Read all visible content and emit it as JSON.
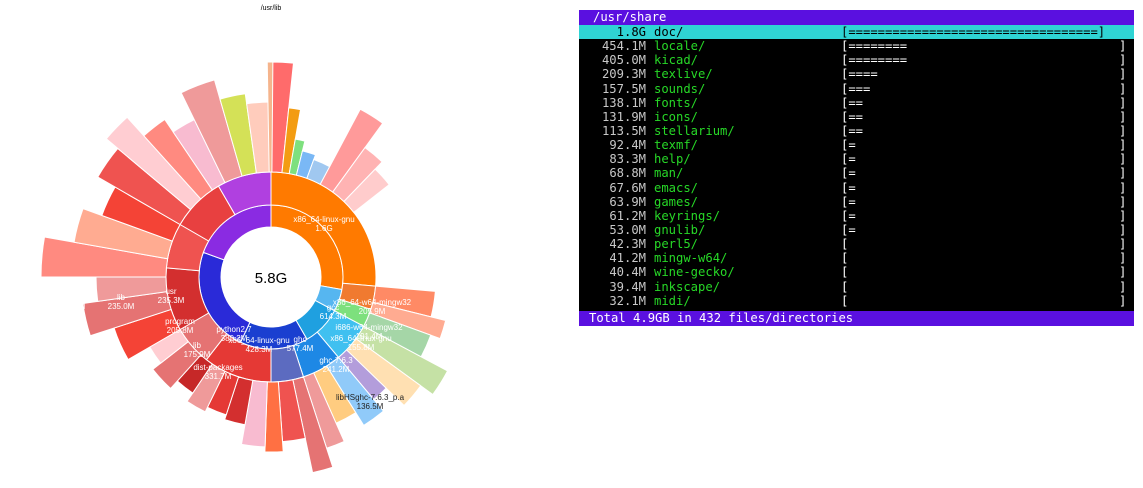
{
  "sunburst": {
    "root_label": "/usr/lib",
    "center_total": "5.8G",
    "labels": [
      {
        "name": "x86_64-linux-gnu",
        "size": "1.6G"
      },
      {
        "name": "usr",
        "size": "235.3M"
      },
      {
        "name": "lib",
        "size": "235.0M"
      },
      {
        "name": "valgrind",
        "size": "227.9M"
      },
      {
        "name": "program",
        "size": "205.8M"
      },
      {
        "name": "lib",
        "size": "175.9M"
      },
      {
        "name": "dist-packages",
        "size": "331.7M"
      },
      {
        "name": "python2.7",
        "size": "380.2M"
      },
      {
        "name": "x86_64-linux-gnu",
        "size": "428.3M"
      },
      {
        "name": "ghc",
        "size": "577.4M"
      },
      {
        "name": "gcc",
        "size": "614.3M"
      },
      {
        "name": "x86_64-w64-mingw32",
        "size": "205.9M"
      },
      {
        "name": "i686-w64-mingw32",
        "size": "191.4M"
      },
      {
        "name": "x86_64-linux-gnu",
        "size": "155.8M"
      },
      {
        "name": "ghc-7.6.3",
        "size": "241.2M"
      },
      {
        "name": "libHSghc-7.6.3_p.a",
        "size": "136.5M"
      }
    ]
  },
  "ncdu": {
    "path": "/usr/share",
    "footer": "Total 4.9GB in 432 files/directories",
    "entries": [
      {
        "size": "1.8G",
        "name": "doc/",
        "bar": "[==================================]",
        "selected": true
      },
      {
        "size": "454.1M",
        "name": "locale/",
        "bar": "[========"
      },
      {
        "size": "405.0M",
        "name": "kicad/",
        "bar": "[========"
      },
      {
        "size": "209.3M",
        "name": "texlive/",
        "bar": "[===="
      },
      {
        "size": "157.5M",
        "name": "sounds/",
        "bar": "[==="
      },
      {
        "size": "138.1M",
        "name": "fonts/",
        "bar": "[=="
      },
      {
        "size": "131.9M",
        "name": "icons/",
        "bar": "[=="
      },
      {
        "size": "113.5M",
        "name": "stellarium/",
        "bar": "[=="
      },
      {
        "size": "92.4M",
        "name": "texmf/",
        "bar": "[="
      },
      {
        "size": "83.3M",
        "name": "help/",
        "bar": "[="
      },
      {
        "size": "68.8M",
        "name": "man/",
        "bar": "[="
      },
      {
        "size": "67.6M",
        "name": "emacs/",
        "bar": "[="
      },
      {
        "size": "63.9M",
        "name": "games/",
        "bar": "[="
      },
      {
        "size": "61.2M",
        "name": "keyrings/",
        "bar": "[="
      },
      {
        "size": "53.0M",
        "name": "gnulib/",
        "bar": "[="
      },
      {
        "size": "42.3M",
        "name": "perl5/",
        "bar": "["
      },
      {
        "size": "41.2M",
        "name": "mingw-w64/",
        "bar": "["
      },
      {
        "size": "40.4M",
        "name": "wine-gecko/",
        "bar": "["
      },
      {
        "size": "39.4M",
        "name": "inkscape/",
        "bar": "["
      },
      {
        "size": "32.1M",
        "name": "midi/",
        "bar": "["
      }
    ]
  }
}
